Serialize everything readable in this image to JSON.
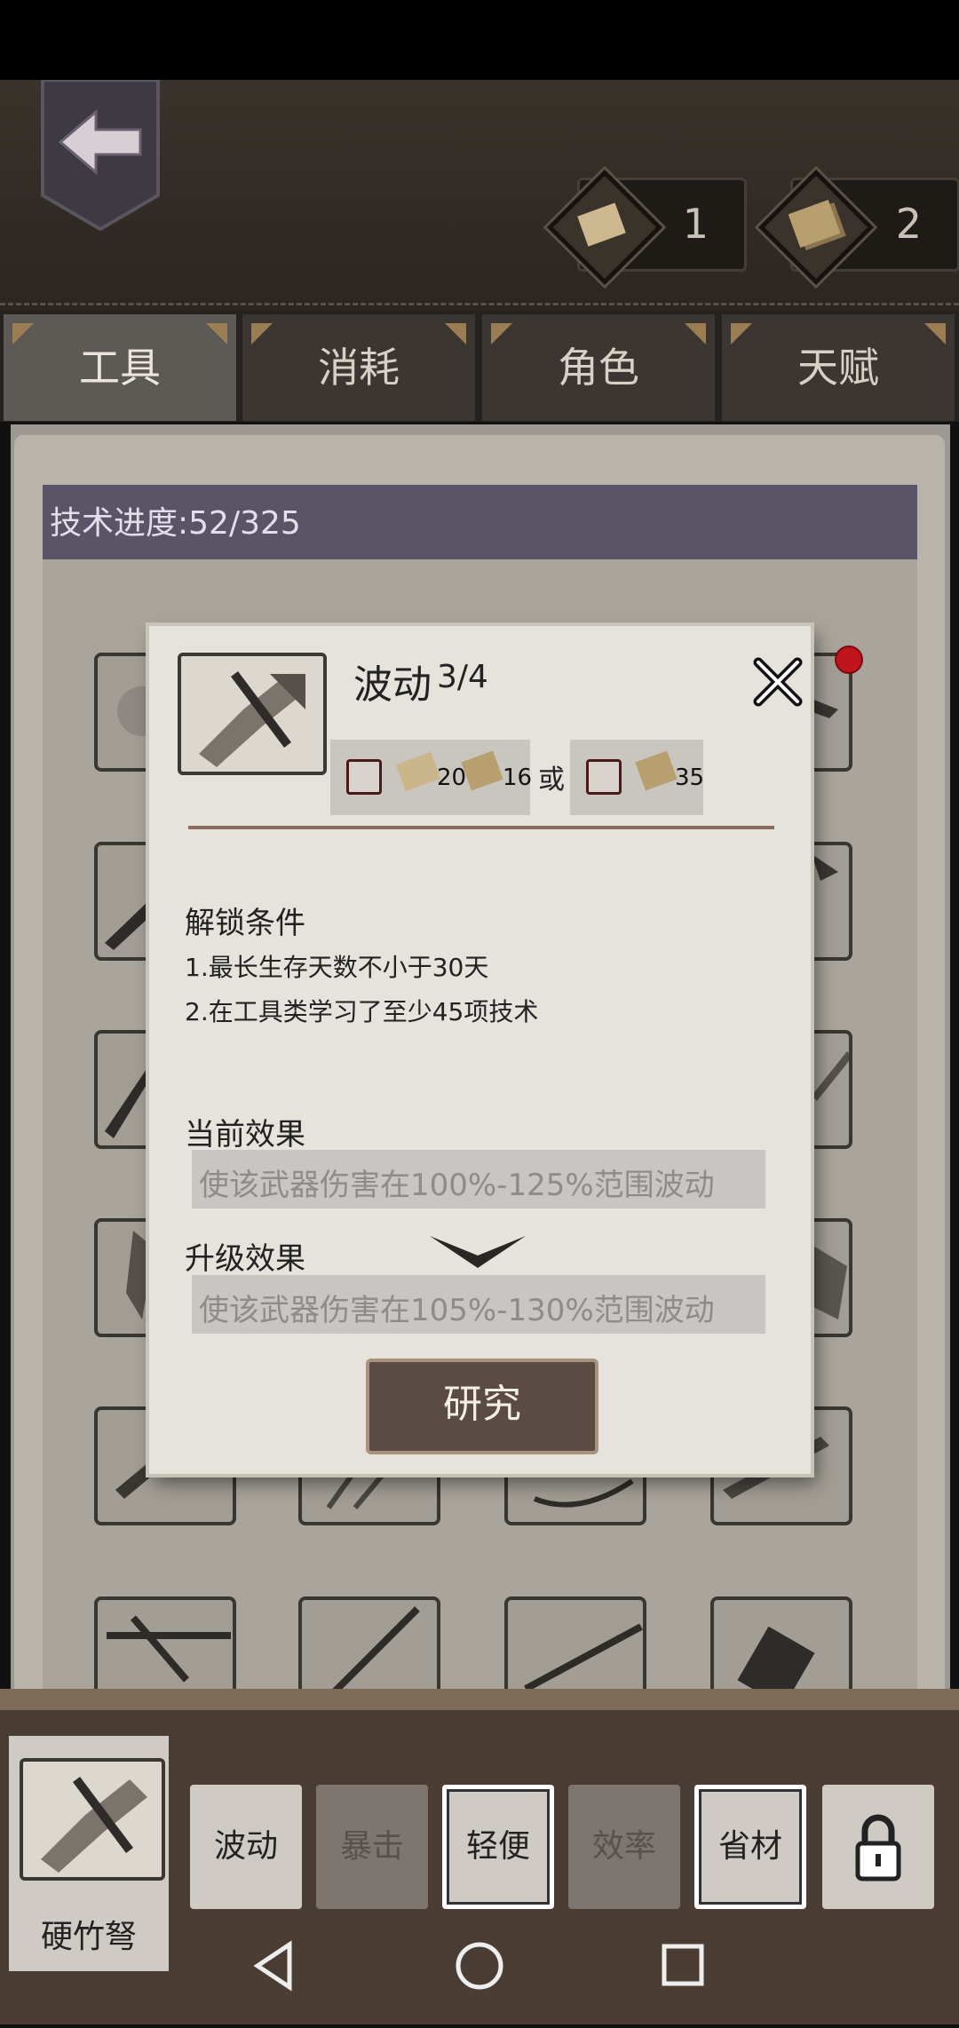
{
  "header": {
    "resources": [
      {
        "icon": "paper-scroll-icon",
        "value": "1"
      },
      {
        "icon": "bundle-scrolls-icon",
        "value": "2"
      }
    ]
  },
  "tabs": [
    {
      "label": "工具",
      "active": true
    },
    {
      "label": "消耗",
      "active": false
    },
    {
      "label": "角色",
      "active": false
    },
    {
      "label": "天赋",
      "active": false
    }
  ],
  "progress": {
    "label": "技术进度:52/325"
  },
  "dialog": {
    "title": "波动",
    "level": "3/4",
    "cost_a1": "200",
    "cost_a2": "16",
    "or": "或",
    "cost_b": "35",
    "unlock_title": "解锁条件",
    "conditions": [
      "1.最长生存天数不小于30天",
      "2.在工具类学习了至少45项技术"
    ],
    "current_title": "当前效果",
    "current_effect": "使该武器伤害在100%-125%范围波动",
    "upgrade_title": "升级效果",
    "upgrade_effect": "使该武器伤害在105%-130%范围波动",
    "research_label": "研究"
  },
  "weapon": {
    "name": "硬竹弩"
  },
  "skills": [
    {
      "label": "波动",
      "state": "active"
    },
    {
      "label": "暴击",
      "state": "dim"
    },
    {
      "label": "轻便",
      "state": "framed"
    },
    {
      "label": "效率",
      "state": "dim"
    },
    {
      "label": "省材",
      "state": "framed"
    },
    {
      "label": "",
      "state": "locked",
      "icon": "lock-icon"
    }
  ],
  "colors": {
    "accent_red": "#c0141c",
    "paper": "#e6e3dc",
    "leather": "#3a332c"
  }
}
